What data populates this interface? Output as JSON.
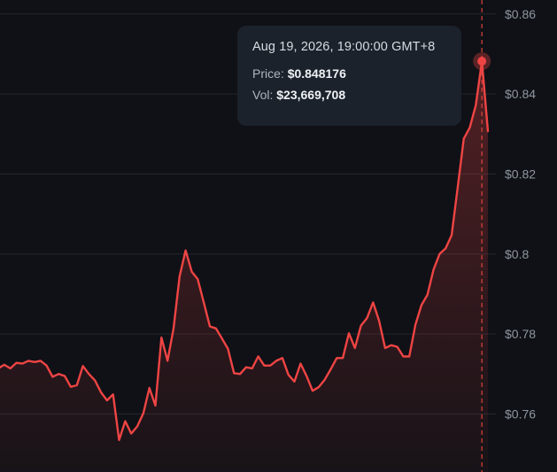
{
  "chart_data": {
    "type": "area",
    "y_ticks": [
      "$0.86",
      "$0.84",
      "$0.82",
      "$0.8",
      "$0.78",
      "$0.76"
    ],
    "y_tick_values": [
      0.86,
      0.84,
      0.82,
      0.8,
      0.78,
      0.76
    ],
    "ylim": [
      0.7455,
      0.8635
    ],
    "grid": true,
    "series": [
      {
        "values": [
          0.7714,
          0.7723,
          0.7714,
          0.7728,
          0.7726,
          0.7733,
          0.773,
          0.7733,
          0.7721,
          0.7693,
          0.77,
          0.7695,
          0.7668,
          0.7672,
          0.772,
          0.77,
          0.7684,
          0.7654,
          0.7634,
          0.7649,
          0.7535,
          0.7582,
          0.7551,
          0.7569,
          0.7602,
          0.7665,
          0.7621,
          0.7791,
          0.7733,
          0.7814,
          0.7944,
          0.8009,
          0.7956,
          0.7937,
          0.7879,
          0.7819,
          0.7814,
          0.7789,
          0.7763,
          0.7702,
          0.77,
          0.7717,
          0.7714,
          0.7744,
          0.7721,
          0.7721,
          0.7733,
          0.774,
          0.7698,
          0.7681,
          0.7726,
          0.7695,
          0.7658,
          0.7667,
          0.7686,
          0.7712,
          0.774,
          0.774,
          0.7802,
          0.7765,
          0.7821,
          0.784,
          0.7879,
          0.7833,
          0.7765,
          0.7772,
          0.7768,
          0.7744,
          0.7744,
          0.7823,
          0.7872,
          0.7898,
          0.7961,
          0.8,
          0.8014,
          0.8047,
          0.8167,
          0.8288,
          0.8316,
          0.8372,
          0.8482,
          0.8307
        ]
      }
    ],
    "highlight": {
      "index": 80,
      "time": "Aug 19, 2026, 19:00:00 GMT+8",
      "price_label": "Price:",
      "price": "$0.848176",
      "vol_label": "Vol:",
      "volume": "$23,669,708"
    }
  },
  "colors": {
    "background": "#0f1116",
    "line": "#ef4444",
    "grid": "#23272f",
    "crosshair": "#e0453b",
    "tooltip_bg": "#1c222b"
  }
}
